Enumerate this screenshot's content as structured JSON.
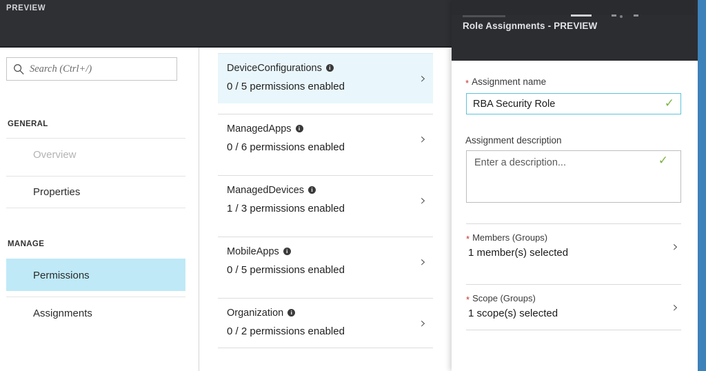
{
  "left_blade": {
    "preview_badge": "PREVIEW",
    "search": {
      "placeholder": "Search (Ctrl+/)",
      "value": "",
      "icon": "search-icon"
    },
    "nav_groups": [
      {
        "title": "GENERAL",
        "items": [
          {
            "label": "Overview",
            "state": "disabled"
          },
          {
            "label": "Properties",
            "state": "normal"
          }
        ]
      },
      {
        "title": "MANAGE",
        "items": [
          {
            "label": "Permissions",
            "state": "selected"
          },
          {
            "label": "Assignments",
            "state": "normal"
          }
        ]
      }
    ]
  },
  "permissions_list": {
    "items": [
      {
        "name": "DeviceConfigurations",
        "status": "0 / 5 permissions enabled",
        "selected": true,
        "info_icon": "info-icon",
        "chevron": "chevron-right-icon"
      },
      {
        "name": "ManagedApps",
        "status": "0 / 6 permissions enabled",
        "selected": false,
        "info_icon": "info-icon",
        "chevron": "chevron-right-icon"
      },
      {
        "name": "ManagedDevices",
        "status": "1 / 3 permissions enabled",
        "selected": false,
        "info_icon": "info-icon",
        "chevron": "chevron-right-icon"
      },
      {
        "name": "MobileApps",
        "status": "0 / 5 permissions enabled",
        "selected": false,
        "info_icon": "info-icon",
        "chevron": "chevron-right-icon"
      },
      {
        "name": "Organization",
        "status": "0 / 2 permissions enabled",
        "selected": false,
        "info_icon": "info-icon",
        "chevron": "chevron-right-icon"
      }
    ]
  },
  "right_blade": {
    "title": "Role Assignments - PREVIEW",
    "window_controls": {
      "minimize": "minimize-icon",
      "maximize": "maximize-icon",
      "close": "close-icon"
    },
    "assignment_name": {
      "label": "Assignment name",
      "required_marker": "*",
      "value": "RBA Security Role",
      "placeholder": "",
      "valid_icon": "check-icon"
    },
    "assignment_description": {
      "label": "Assignment description",
      "value": "",
      "placeholder": "Enter a description...",
      "valid_icon": "check-icon"
    },
    "pickers": [
      {
        "label": "Members (Groups)",
        "required_marker": "*",
        "value": "1 member(s) selected",
        "chevron": "chevron-right-icon"
      },
      {
        "label": "Scope (Groups)",
        "required_marker": "*",
        "value": "1 scope(s) selected",
        "chevron": "chevron-right-icon"
      }
    ]
  },
  "colors": {
    "header_dark": "#2e3033",
    "panel_dark": "#2b2d31",
    "sidebar_selected": "#bfe9f7",
    "card_selected": "#e9f6fc",
    "input_focus_border": "#5ec2da",
    "valid_green": "#7cb342",
    "required_red": "#c4342d",
    "edge_blue": "#3d82b8"
  }
}
